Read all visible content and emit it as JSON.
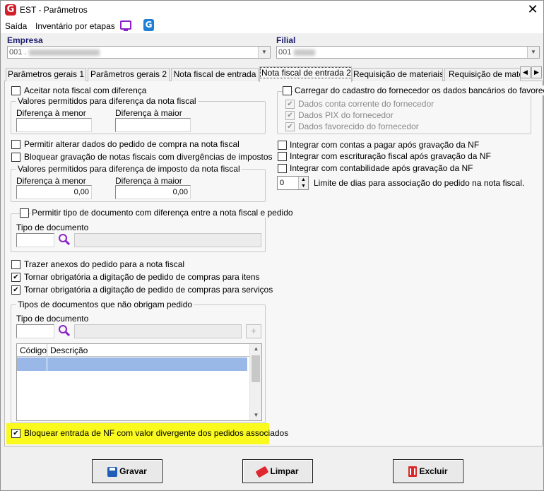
{
  "window": {
    "title": "EST - Parâmetros",
    "close_glyph": "✕",
    "logo_glyph": "G"
  },
  "menu": {
    "items": [
      "Saída",
      "Inventário por etapas"
    ],
    "g_glyph": "G"
  },
  "company": {
    "label": "Empresa",
    "value": "001 ."
  },
  "branch": {
    "label": "Filial",
    "value": "001"
  },
  "tabs": [
    "Parâmetros gerais 1",
    "Parâmetros gerais 2",
    "Nota fiscal de entrada",
    "Nota fiscal de entrada 2",
    "Requisição de materiais",
    "Requisição de materi"
  ],
  "tab_scroll": {
    "left": "◀",
    "right": "▶"
  },
  "left": {
    "accept_diff": {
      "label": "Aceitar nota fiscal com diferença",
      "checked": false
    },
    "nf_diff_group": {
      "title": "Valores permitidos para diferença da nota fiscal",
      "lower_label": "Diferença à menor",
      "lower_value": "",
      "higher_label": "Diferença à maior",
      "higher_value": ""
    },
    "allow_change_order": {
      "label": "Permitir alterar dados do pedido de compra na nota fiscal",
      "checked": false
    },
    "block_tax_diff": {
      "label": "Bloquear gravação de notas fiscais com divergências de impostos",
      "checked": false
    },
    "tax_diff_group": {
      "title": "Valores permitidos para diferença de imposto da nota fiscal",
      "lower_label": "Diferença à menor",
      "lower_value": "0,00",
      "higher_label": "Diferença à maior",
      "higher_value": "0,00"
    },
    "doc_type_group": {
      "title": "Permitir tipo de documento com diferença entre a nota fiscal e pedido",
      "checked": false,
      "field_label": "Tipo de documento"
    },
    "bring_attachments": {
      "label": "Trazer anexos do pedido para a nota fiscal",
      "checked": false
    },
    "require_items": {
      "label": "Tornar obrigatória a digitação de pedido de compras para itens",
      "checked": true
    },
    "require_services": {
      "label": "Tornar obrigatória a digitação de pedido de compras para serviços",
      "checked": true
    },
    "no_order_group": {
      "title": "Tipos de documentos que não obrigam pedido",
      "field_label": "Tipo de documento",
      "plus": "+",
      "columns": [
        "Código",
        "Descrição"
      ]
    },
    "block_divergent": {
      "label": "Bloquear entrada de NF com valor divergente dos pedidos associados",
      "checked": true
    }
  },
  "right": {
    "bank_group": {
      "title": "Carregar do cadastro do fornecedor os dados bancários do favorecido",
      "checked": false,
      "items": [
        {
          "label": "Dados conta corrente do fornecedor",
          "checked": true
        },
        {
          "label": "Dados PIX do fornecedor",
          "checked": true
        },
        {
          "label": "Dados favorecido do fornecedor",
          "checked": true
        }
      ]
    },
    "integrate_payables": {
      "label": "Integrar com contas a pagar após gravação da NF",
      "checked": false
    },
    "integrate_tax": {
      "label": "Integrar com escrituração fiscal após gravação da NF",
      "checked": false
    },
    "integrate_accounting": {
      "label": "Integrar com contabilidade após gravação da NF",
      "checked": false
    },
    "days_limit": {
      "value": "0",
      "label": "Limite de dias para associação do pedido na nota fiscal."
    }
  },
  "buttons": {
    "save": "Gravar",
    "clear": "Limpar",
    "delete": "Excluir"
  },
  "colors": {
    "highlight": "#fafa1e",
    "accent_blue": "#1a1a6e",
    "purple_icon": "#8b1fc9",
    "brand_red": "#d21f2b"
  }
}
